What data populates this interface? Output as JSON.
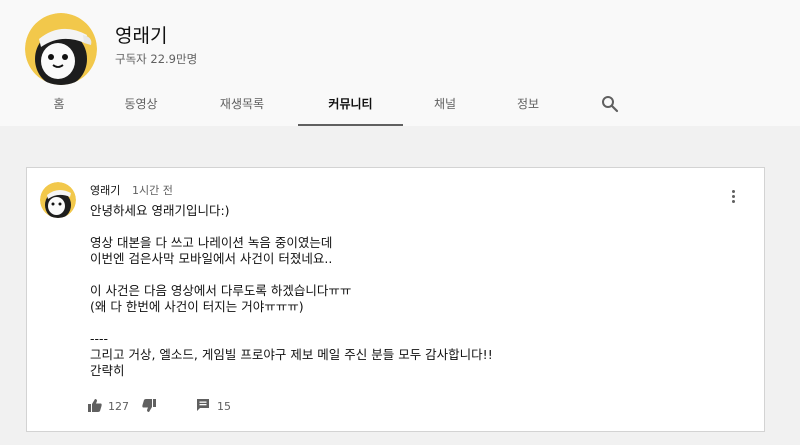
{
  "channel": {
    "name": "영래기",
    "subscribers": "구독자 22.9만명"
  },
  "tabs": [
    {
      "label": "홈"
    },
    {
      "label": "동영상"
    },
    {
      "label": "재생목록"
    },
    {
      "label": "커뮤니티",
      "active": true
    },
    {
      "label": "채널"
    },
    {
      "label": "정보"
    }
  ],
  "post": {
    "author": "영래기",
    "time": "1시간 전",
    "lines": [
      "안녕하세요 영래기입니다:)",
      "",
      "영상 대본을 다 쓰고 나레이션 녹음 중이였는데",
      "이번엔 검은사막 모바일에서 사건이 터졌네요..",
      "",
      "이 사건은 다음 영상에서 다루도록 하겠습니다ㅠㅠ",
      "(왜 다 한번에 사건이 터지는 거야ㅠㅠㅠ)",
      "",
      "----",
      "그리고 거상, 엘소드, 게임빌 프로야구 제보 메일 주신 분들 모두 감사합니다!!",
      "간략히"
    ],
    "likes": "127",
    "comments": "15"
  },
  "icons": {
    "search": "search-icon",
    "like": "thumb-up-icon",
    "dislike": "thumb-down-icon",
    "comment": "comment-icon",
    "more": "more-vert-icon"
  },
  "colors": {
    "header_bg": "#f9f9f9",
    "page_bg": "#f1f1f1",
    "card_bg": "#ffffff",
    "secondary_text": "#606060"
  }
}
